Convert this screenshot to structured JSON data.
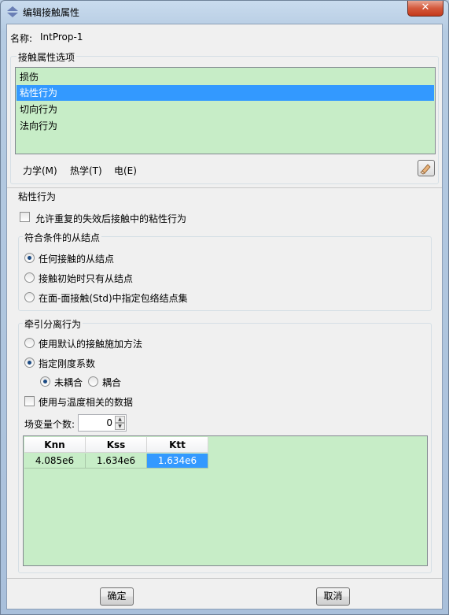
{
  "window": {
    "title": "编辑接触属性",
    "close_label": "✕"
  },
  "name": {
    "label": "名称:",
    "value": "IntProp-1"
  },
  "options": {
    "title": "接触属性选项",
    "items": [
      "损伤",
      "粘性行为",
      "切向行为",
      "法向行为"
    ],
    "selected_index": 1,
    "list_bg_color": "#c7edc7",
    "selected_color": "#3399ff"
  },
  "menu": {
    "mechanical": "力学(M)",
    "thermal": "热学(T)",
    "electrical": "电(E)"
  },
  "section": {
    "title": "粘性行为",
    "allow_repeated_label": "允许重复的失效后接触中的粘性行为",
    "allow_repeated_checked": false
  },
  "slave_nodes": {
    "title": "符合条件的从结点",
    "options": [
      "任何接触的从结点",
      "接触初始时只有从结点",
      "在面-面接触(Std)中指定包络结点集"
    ],
    "selected_index": 0
  },
  "traction": {
    "title": "牵引分离行为",
    "default_label": "使用默认的接触施加方法",
    "specify_label": "指定刚度系数",
    "selected": "specify",
    "uncoupled_label": "未耦合",
    "coupled_label": "耦合",
    "coupling_selected": "uncoupled",
    "temp_label": "使用与温度相关的数据",
    "temp_checked": false,
    "field_vars_label": "场变量个数:",
    "field_vars_value": "0"
  },
  "table": {
    "headers": [
      "Knn",
      "Kss",
      "Ktt"
    ],
    "rows": [
      [
        "4.085e6",
        "1.634e6",
        "1.634e6"
      ]
    ],
    "selected_cell": [
      0,
      2
    ]
  },
  "buttons": {
    "ok": "确定",
    "cancel": "取消"
  }
}
